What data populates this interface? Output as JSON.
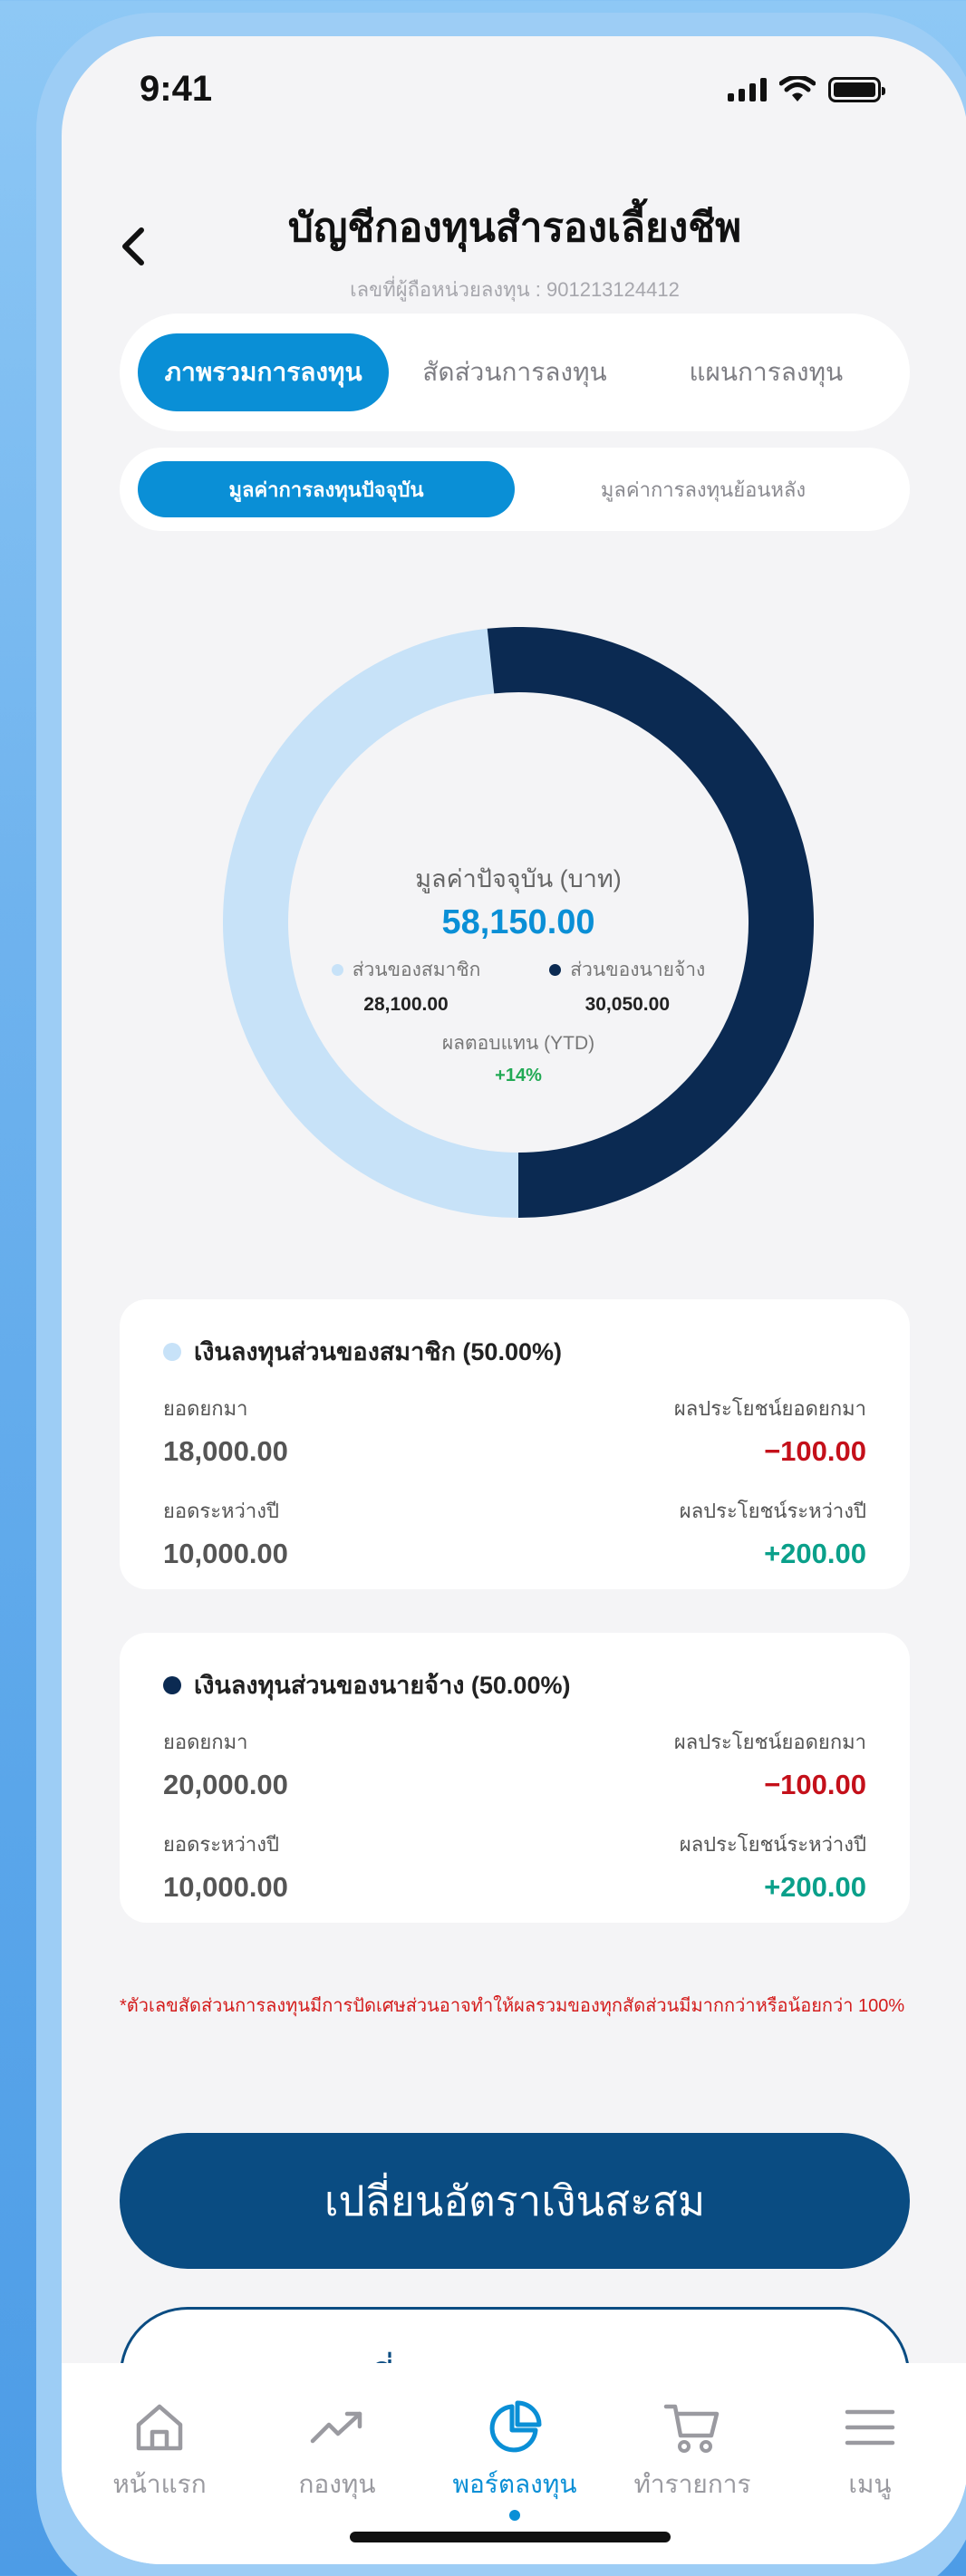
{
  "status_bar": {
    "time": "9:41"
  },
  "header": {
    "title": "บัญชีกองทุนสำรองเลี้ยงชีพ",
    "subtitle": "เลขที่ผู้ถือหน่วยลงทุน : 901213124412"
  },
  "tabs": [
    {
      "label": "ภาพรวมการลงทุน",
      "active": true
    },
    {
      "label": "สัดส่วนการลงทุน",
      "active": false
    },
    {
      "label": "แผนการลงทุน",
      "active": false
    }
  ],
  "subtabs": [
    {
      "label": "มูลค่าการลงทุนปัจจุบัน",
      "active": true
    },
    {
      "label": "มูลค่าการลงทุนย้อนหลัง",
      "active": false
    }
  ],
  "colors": {
    "accent": "#0a8fd6",
    "member": "#c7e2f8",
    "employer": "#0b2a52",
    "negative": "#c4101a",
    "positive": "#0aa08a",
    "primary_button": "#0a4c82"
  },
  "chart_data": {
    "type": "pie",
    "donut": true,
    "categories": [
      "ส่วนของสมาชิก",
      "ส่วนของนายจ้าง"
    ],
    "values": [
      28100.0,
      30050.0
    ],
    "colors": [
      "#c7e2f8",
      "#0b2a52"
    ],
    "center_label": "มูลค่าปัจจุบัน (บาท)",
    "center_value": "58,150.00",
    "legend": [
      {
        "label": "ส่วนของสมาชิก",
        "value": "28,100.00",
        "color": "#c7e2f8"
      },
      {
        "label": "ส่วนของนายจ้าง",
        "value": "30,050.00",
        "color": "#0b2a52"
      }
    ],
    "return_label": "ผลตอบแทน (YTD)",
    "return_value": "+14%"
  },
  "cards": [
    {
      "title": "เงินลงทุนส่วนของสมาชิก (50.00%)",
      "color": "#c7e2f8",
      "rows": [
        {
          "left_key": "ยอดยกมา",
          "left_val": "18,000.00",
          "right_key": "ผลประโยชน์ยอดยกมา",
          "right_val": "−100.00",
          "right_sign": "neg"
        },
        {
          "left_key": "ยอดระหว่างปี",
          "left_val": "10,000.00",
          "right_key": "ผลประโยชน์ระหว่างปี",
          "right_val": "+200.00",
          "right_sign": "pos"
        }
      ]
    },
    {
      "title": "เงินลงทุนส่วนของนายจ้าง (50.00%)",
      "color": "#0b2a52",
      "rows": [
        {
          "left_key": "ยอดยกมา",
          "left_val": "20,000.00",
          "right_key": "ผลประโยชน์ยอดยกมา",
          "right_val": "−100.00",
          "right_sign": "neg"
        },
        {
          "left_key": "ยอดระหว่างปี",
          "left_val": "10,000.00",
          "right_key": "ผลประโยชน์ระหว่างปี",
          "right_val": "+200.00",
          "right_sign": "pos"
        }
      ]
    }
  ],
  "note": "*ตัวเลขสัดส่วนการลงทุนมีการปัดเศษส่วนอาจทำให้ผลรวมของทุกสัดส่วนมีมากกว่าหรือน้อยกว่า 100%",
  "buttons": {
    "primary": "เปลี่ยนอัตราเงินสะสม",
    "secondary": "เปลี่ยนแผนการลงทุน"
  },
  "bottom_nav": [
    {
      "label": "หน้าแรก",
      "icon": "home-icon",
      "active": false
    },
    {
      "label": "กองทุน",
      "icon": "trend-icon",
      "active": false
    },
    {
      "label": "พอร์ตลงทุน",
      "icon": "pie-chart-icon",
      "active": true
    },
    {
      "label": "ทำรายการ",
      "icon": "cart-icon",
      "active": false
    },
    {
      "label": "เมนู",
      "icon": "menu-icon",
      "active": false
    }
  ]
}
